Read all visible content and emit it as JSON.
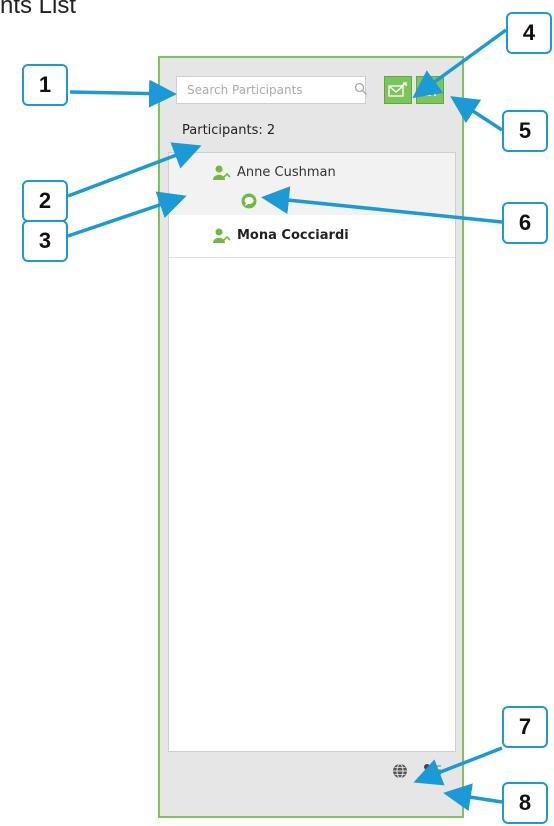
{
  "page": {
    "title_fragment": "nts List"
  },
  "search": {
    "placeholder": "Search Participants",
    "icon": "magnifier-icon"
  },
  "toolbar": {
    "invite_email_icon": "envelope-arrow-icon",
    "add_participant_icon": "person-plus-icon"
  },
  "participants": {
    "count_label": "Participants: 2",
    "items": [
      {
        "name": "Anne Cushman",
        "bold": false,
        "has_chat": true
      },
      {
        "name": "Mona Cocciardi",
        "bold": true,
        "has_chat": false
      }
    ]
  },
  "footer": {
    "globe_icon": "globe-icon",
    "attendee_list_icon": "person-list-icon"
  },
  "callouts": [
    "1",
    "2",
    "3",
    "4",
    "5",
    "6",
    "7",
    "8"
  ],
  "colors": {
    "accent_green": "#7dc55a",
    "callout_blue": "#1a9ad6",
    "panel_bg": "#e6e6e6"
  }
}
